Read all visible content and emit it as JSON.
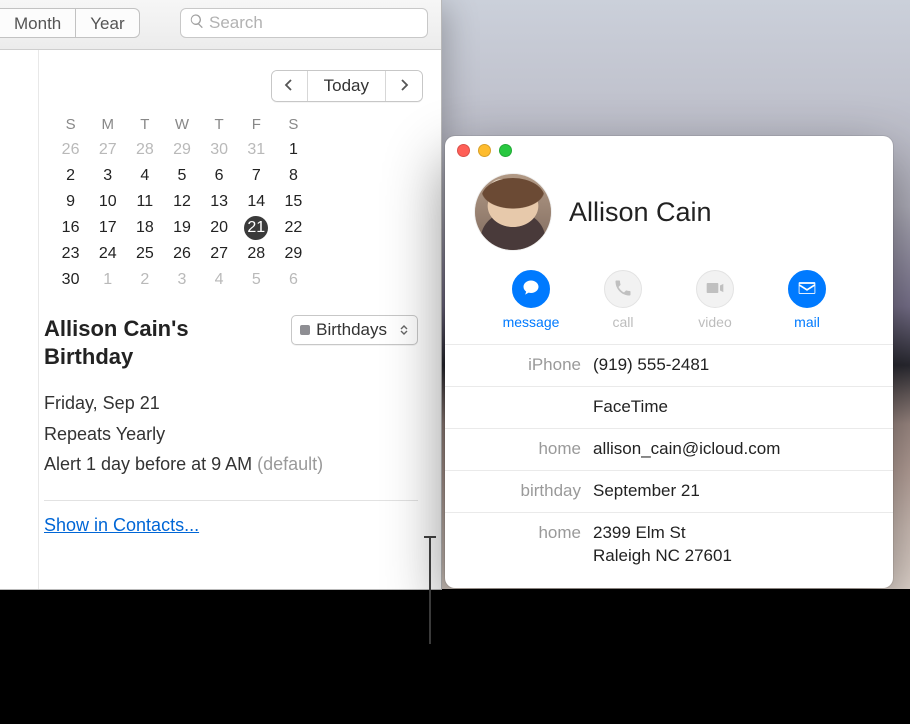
{
  "calendar": {
    "toolbar": {
      "segments": [
        "Month",
        "Year"
      ],
      "search_placeholder": "Search"
    },
    "nav": {
      "prev_icon": "chevron-left",
      "today_label": "Today",
      "next_icon": "chevron-right"
    },
    "mini": {
      "dow": [
        "S",
        "M",
        "T",
        "W",
        "T",
        "F",
        "S"
      ],
      "weeks": [
        [
          {
            "n": 26,
            "dim": true
          },
          {
            "n": 27,
            "dim": true
          },
          {
            "n": 28,
            "dim": true
          },
          {
            "n": 29,
            "dim": true
          },
          {
            "n": 30,
            "dim": true
          },
          {
            "n": 31,
            "dim": true
          },
          {
            "n": 1
          }
        ],
        [
          {
            "n": 2
          },
          {
            "n": 3
          },
          {
            "n": 4
          },
          {
            "n": 5
          },
          {
            "n": 6
          },
          {
            "n": 7
          },
          {
            "n": 8
          }
        ],
        [
          {
            "n": 9
          },
          {
            "n": 10
          },
          {
            "n": 11
          },
          {
            "n": 12
          },
          {
            "n": 13
          },
          {
            "n": 14
          },
          {
            "n": 15
          }
        ],
        [
          {
            "n": 16
          },
          {
            "n": 17
          },
          {
            "n": 18
          },
          {
            "n": 19
          },
          {
            "n": 20
          },
          {
            "n": 21,
            "sel": true
          },
          {
            "n": 22
          }
        ],
        [
          {
            "n": 23
          },
          {
            "n": 24
          },
          {
            "n": 25
          },
          {
            "n": 26
          },
          {
            "n": 27
          },
          {
            "n": 28
          },
          {
            "n": 29
          }
        ],
        [
          {
            "n": 30
          },
          {
            "n": 1,
            "dim": true
          },
          {
            "n": 2,
            "dim": true
          },
          {
            "n": 3,
            "dim": true
          },
          {
            "n": 4,
            "dim": true
          },
          {
            "n": 5,
            "dim": true
          },
          {
            "n": 6,
            "dim": true
          }
        ]
      ]
    },
    "event": {
      "title": "Allison Cain's Birthday",
      "calendar_select": "Birthdays",
      "date_line": "Friday, Sep 21",
      "repeat_line": "Repeats Yearly",
      "alert_line_main": "Alert 1 day before at 9 AM ",
      "alert_line_muted": "(default)",
      "show_in_contacts": "Show in Contacts..."
    }
  },
  "contact": {
    "name": "Allison Cain",
    "actions": {
      "message": "message",
      "call": "call",
      "video": "video",
      "mail": "mail"
    },
    "fields": [
      {
        "label": "iPhone",
        "value": "(919) 555-2481"
      },
      {
        "label": "",
        "value": "FaceTime"
      },
      {
        "label": "home",
        "value": "allison_cain@icloud.com"
      },
      {
        "label": "birthday",
        "value": "September 21"
      },
      {
        "label": "home",
        "value": "2399 Elm St\nRaleigh NC 27601"
      }
    ]
  }
}
